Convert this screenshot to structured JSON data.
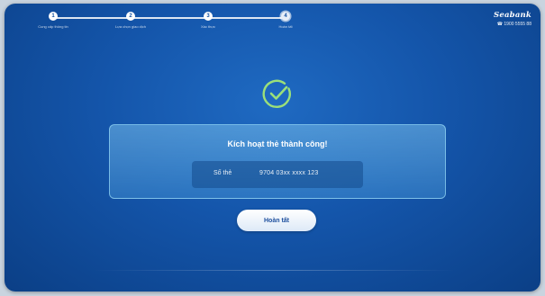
{
  "stepper": {
    "steps": [
      {
        "number": "1",
        "label": "Cung cấp thông tin",
        "state": "done"
      },
      {
        "number": "2",
        "label": "Lựa chọn giao dịch",
        "state": "done"
      },
      {
        "number": "3",
        "label": "Xác thực",
        "state": "done"
      },
      {
        "number": "4",
        "label": "Hoàn tất",
        "state": "current"
      }
    ]
  },
  "brand": {
    "logo_text": "Seabank",
    "hotline": "1900 5555 88"
  },
  "success_icon": "check-circle-icon",
  "card": {
    "title": "Kích hoạt thẻ thành công!",
    "card_number_label": "Số thẻ",
    "card_number_value": "9704 03xx xxxx 123"
  },
  "finish_button": {
    "label": "Hoàn tất"
  },
  "colors": {
    "background": "#1455aa",
    "accent": "#9be07a",
    "button_text": "#1d4f9e"
  }
}
